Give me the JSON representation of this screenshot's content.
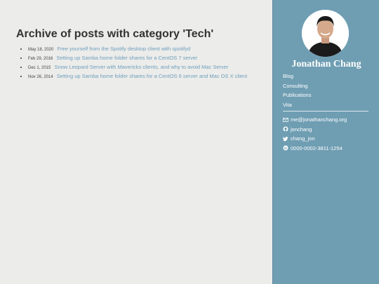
{
  "main": {
    "title": "Archive of posts with category 'Tech'",
    "posts": [
      {
        "date": "May 18, 2020",
        "title": "Free yourself from the Spotify desktop client with spotifyd"
      },
      {
        "date": "Feb 29, 2016",
        "title": "Setting up Samba home folder shares for a CentOS 7 server"
      },
      {
        "date": "Dec 1, 2015",
        "title": "Snow Leopard Server with Mavericks clients, and why to avoid Mac Server"
      },
      {
        "date": "Nov 26, 2014",
        "title": "Setting up Samba home folder shares for a CentOS 6 server and Mac OS X client"
      }
    ]
  },
  "sidebar": {
    "name": "Jonathan Chang",
    "nav": [
      "Blog",
      "Consulting",
      "Publications",
      "Vita"
    ],
    "contacts": [
      {
        "icon": "envelope-icon",
        "text": "me@jonathanchang.org"
      },
      {
        "icon": "github-icon",
        "text": "jonchang"
      },
      {
        "icon": "twitter-icon",
        "text": "chang_jon"
      },
      {
        "icon": "orcid-icon",
        "text": "0000-0002-3811-1254"
      }
    ]
  },
  "colors": {
    "sidebar_bg": "#6f9eb3",
    "link": "#6fa0bd",
    "page_bg": "#ececea"
  }
}
